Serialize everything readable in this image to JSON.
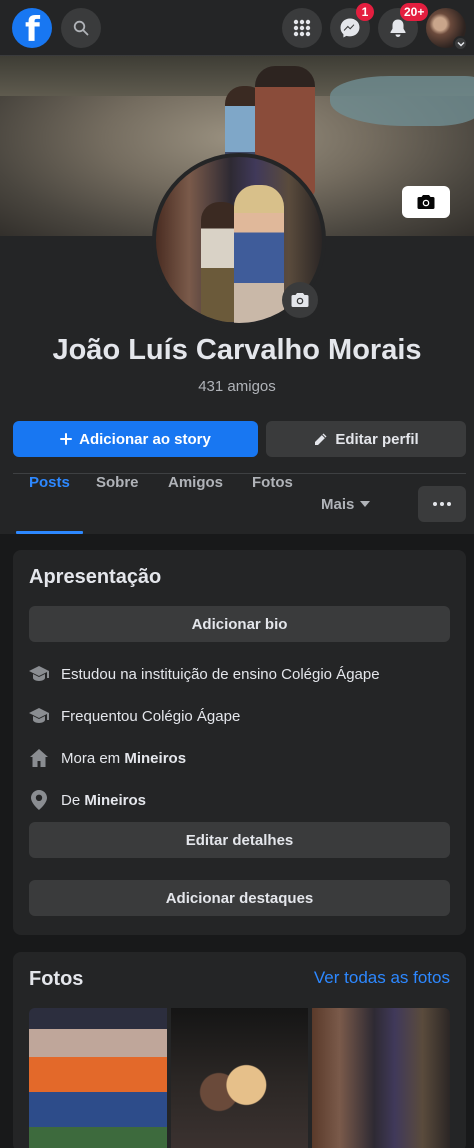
{
  "topbar": {
    "logo_letter": "f",
    "messenger_badge": "1",
    "notifications_badge": "20+"
  },
  "profile": {
    "name": "João Luís Carvalho Morais",
    "friends": "431 amigos",
    "add_story_label": "Adicionar ao story",
    "edit_profile_label": "Editar perfil"
  },
  "tabs": [
    {
      "label": "Posts",
      "active": true
    },
    {
      "label": "Sobre"
    },
    {
      "label": "Amigos"
    },
    {
      "label": "Fotos"
    },
    {
      "label": "Mais"
    }
  ],
  "intro": {
    "title": "Apresentação",
    "add_bio_label": "Adicionar bio",
    "items": [
      {
        "icon": "graduation-cap-icon",
        "prefix": "Estudou na instituição de ensino Colégio Ágape",
        "bold": ""
      },
      {
        "icon": "graduation-cap-icon",
        "prefix": "Frequentou Colégio Ágape",
        "bold": ""
      },
      {
        "icon": "home-icon",
        "prefix": "Mora em ",
        "bold": "Mineiros"
      },
      {
        "icon": "location-pin-icon",
        "prefix": "De ",
        "bold": "Mineiros"
      }
    ],
    "edit_details_label": "Editar detalhes",
    "add_featured_label": "Adicionar destaques"
  },
  "photos": {
    "title": "Fotos",
    "see_all_label": "Ver todas as fotos"
  },
  "colors": {
    "background": "#18191a",
    "surface": "#242526",
    "button_gray": "#3a3b3c",
    "accent": "#1877f2",
    "link": "#2d88ff",
    "badge": "#e41e3f"
  }
}
